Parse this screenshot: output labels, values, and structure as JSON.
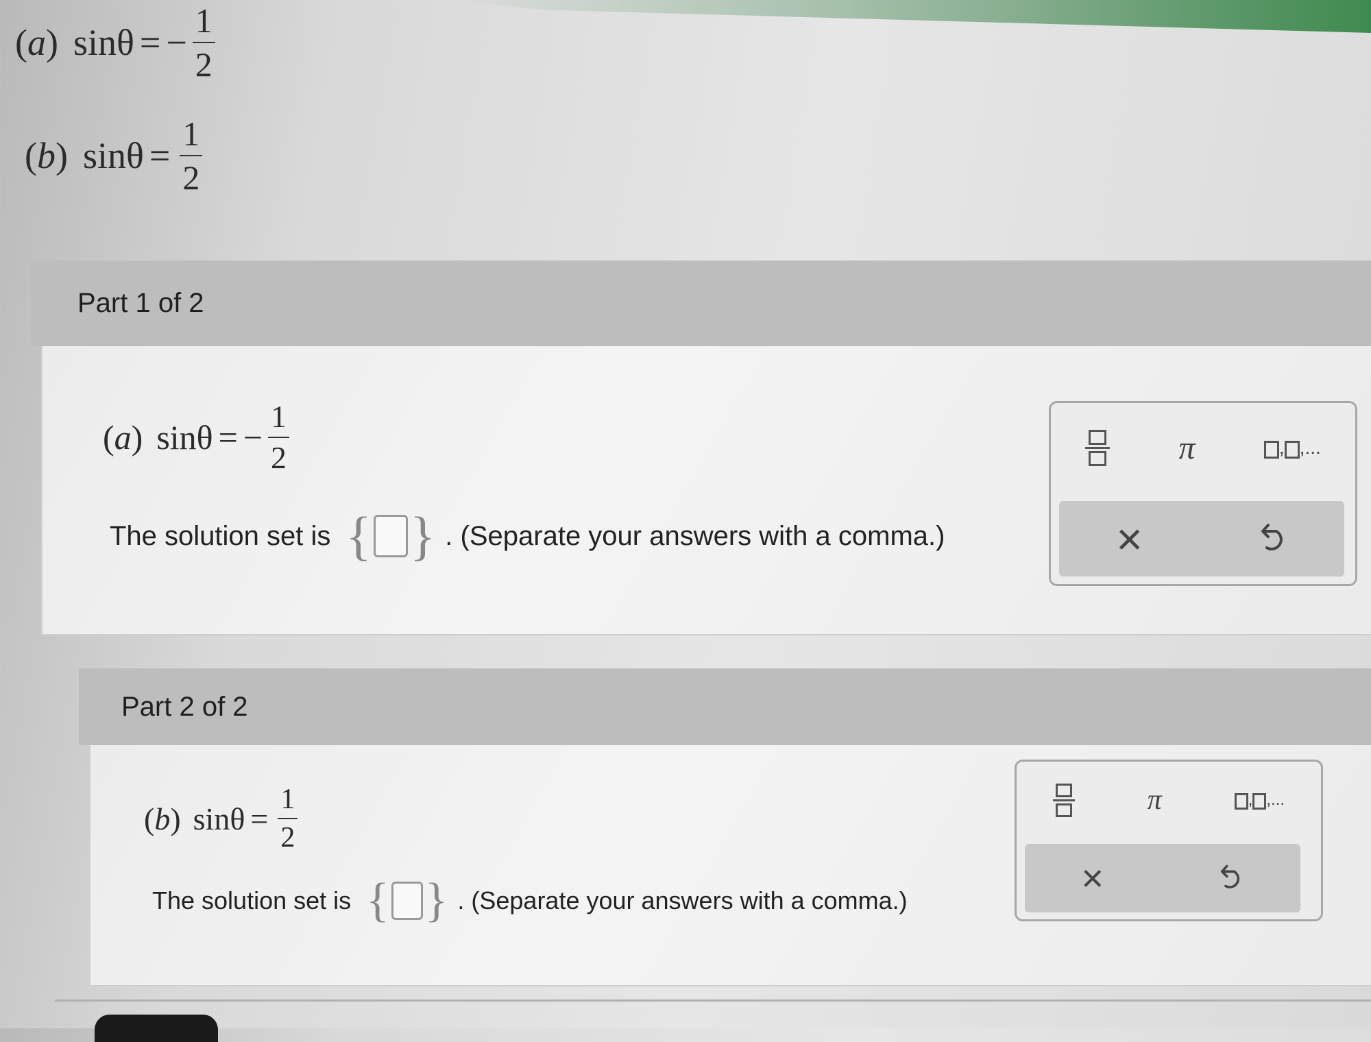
{
  "problems": {
    "a": {
      "label": "a",
      "lhs": "sinθ",
      "eq": "=",
      "sign": "−",
      "num": "1",
      "den": "2"
    },
    "b": {
      "label": "b",
      "lhs": "sinθ",
      "eq": "=",
      "sign": "",
      "num": "1",
      "den": "2"
    }
  },
  "parts": [
    {
      "header": "Part 1 of 2",
      "solution_prefix": "The solution set is",
      "answer_value": "",
      "hint": ". (Separate your answers with a comma.)"
    },
    {
      "header": "Part 2 of 2",
      "solution_prefix": "The solution set is",
      "answer_value": "",
      "hint": ". (Separate your answers with a comma.)"
    }
  ],
  "palette": {
    "fraction_tool": "fraction-icon",
    "pi_symbol": "π",
    "sequence_tail": "...",
    "clear_symbol": "×",
    "undo_icon": "undo-icon"
  }
}
